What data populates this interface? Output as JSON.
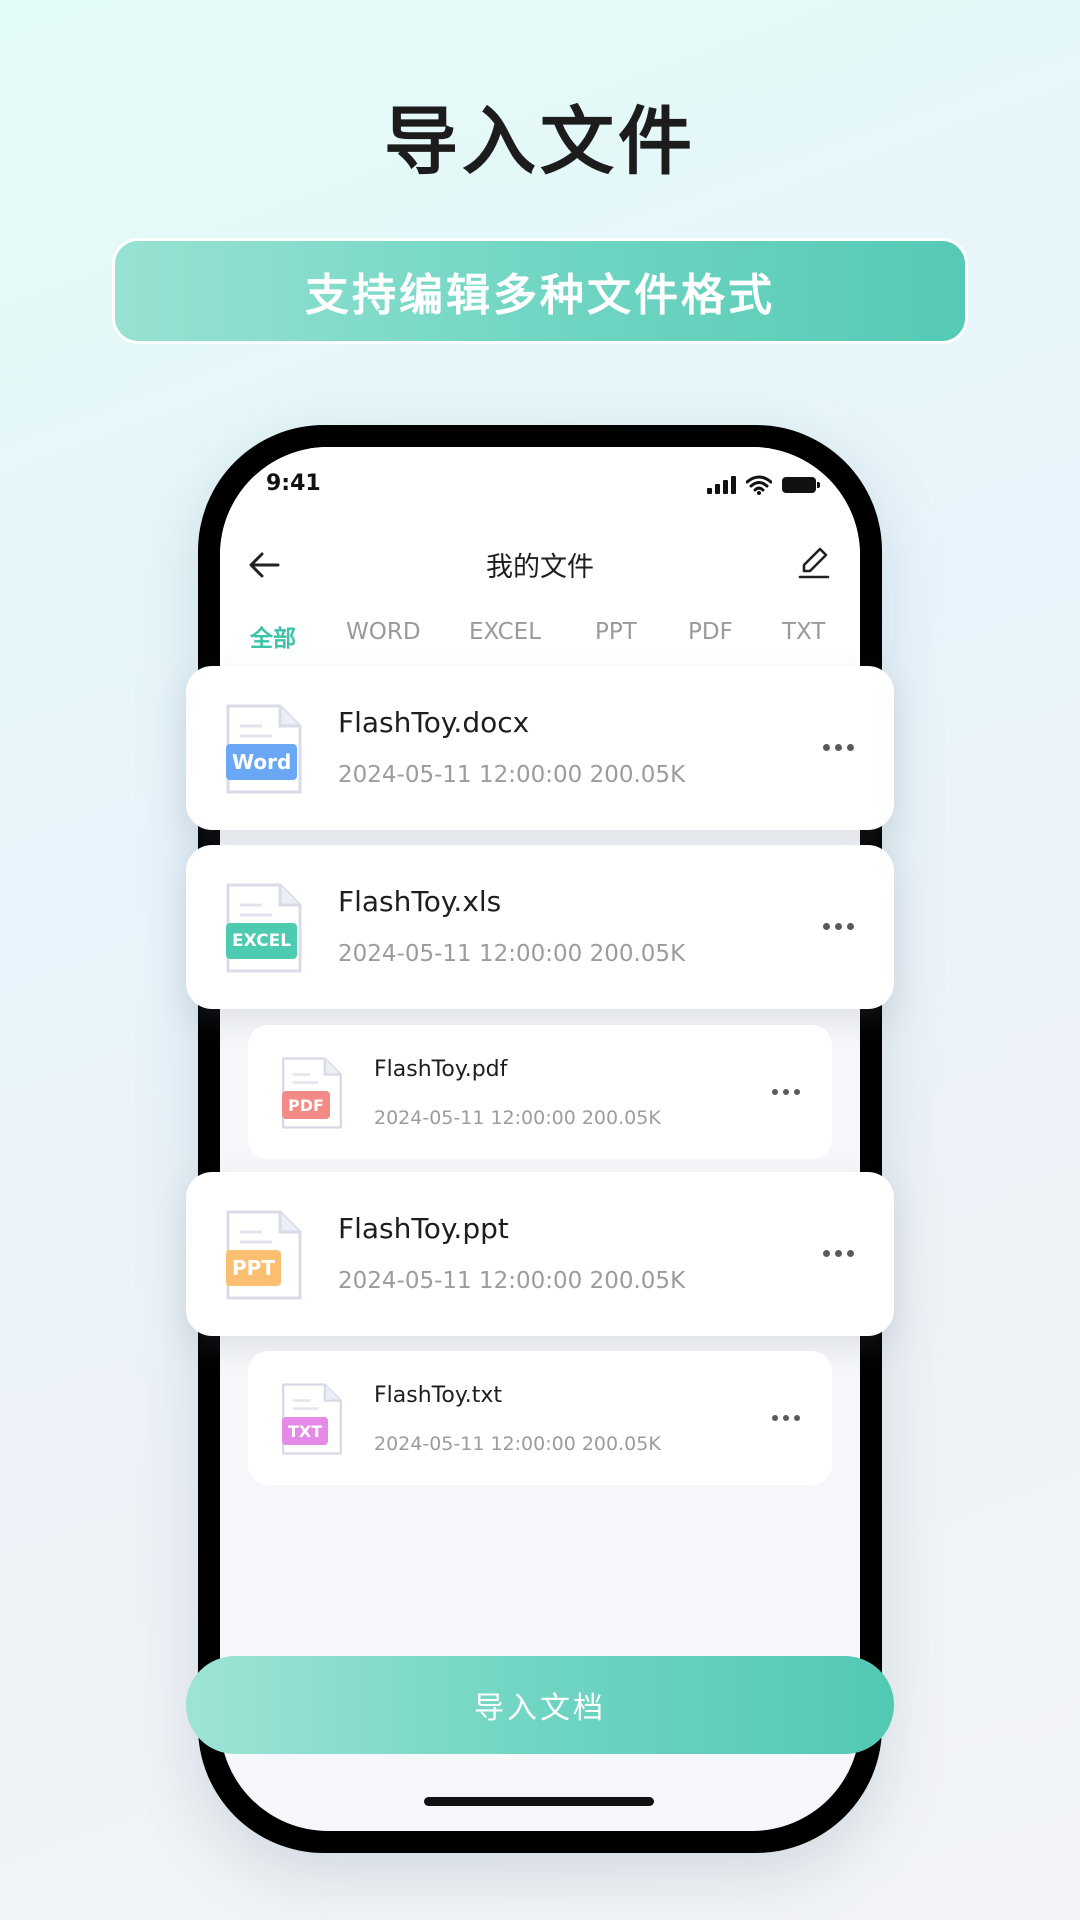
{
  "hero": {
    "title": "导入文件",
    "banner": "支持编辑多种文件格式"
  },
  "status_bar": {
    "time": "9:41",
    "icons": [
      "signal-icon",
      "wifi-icon",
      "battery-icon"
    ]
  },
  "nav": {
    "back_icon": "arrow-left-icon",
    "title": "我的文件",
    "edit_icon": "edit-icon"
  },
  "tabs": [
    {
      "label": "全部",
      "active": true
    },
    {
      "label": "WORD",
      "active": false
    },
    {
      "label": "EXCEL",
      "active": false
    },
    {
      "label": "PPT",
      "active": false
    },
    {
      "label": "PDF",
      "active": false
    },
    {
      "label": "TXT",
      "active": false
    }
  ],
  "files": [
    {
      "name": "FlashToy.docx",
      "meta": "2024-05-11 12:00:00 200.05K",
      "badge": "Word",
      "badge_color": "#6aa8f5"
    },
    {
      "name": "FlashToy.xls",
      "meta": "2024-05-11 12:00:00 200.05K",
      "badge": "EXCEL",
      "badge_color": "#4ccbb0"
    },
    {
      "name": "FlashToy.pdf",
      "meta": "2024-05-11 12:00:00 200.05K",
      "badge": "PDF",
      "badge_color": "#f48a86"
    },
    {
      "name": "FlashToy.ppt",
      "meta": "2024-05-11 12:00:00 200.05K",
      "badge": "PPT",
      "badge_color": "#fbbf72"
    },
    {
      "name": "FlashToy.txt",
      "meta": "2024-05-11 12:00:00 200.05K",
      "badge": "TXT",
      "badge_color": "#e58ae6"
    }
  ],
  "import_button": "导入文档",
  "colors": {
    "accent": "#3ec3aa",
    "button_gradient_start": "#9ee4d6",
    "button_gradient_end": "#52c9b3"
  }
}
